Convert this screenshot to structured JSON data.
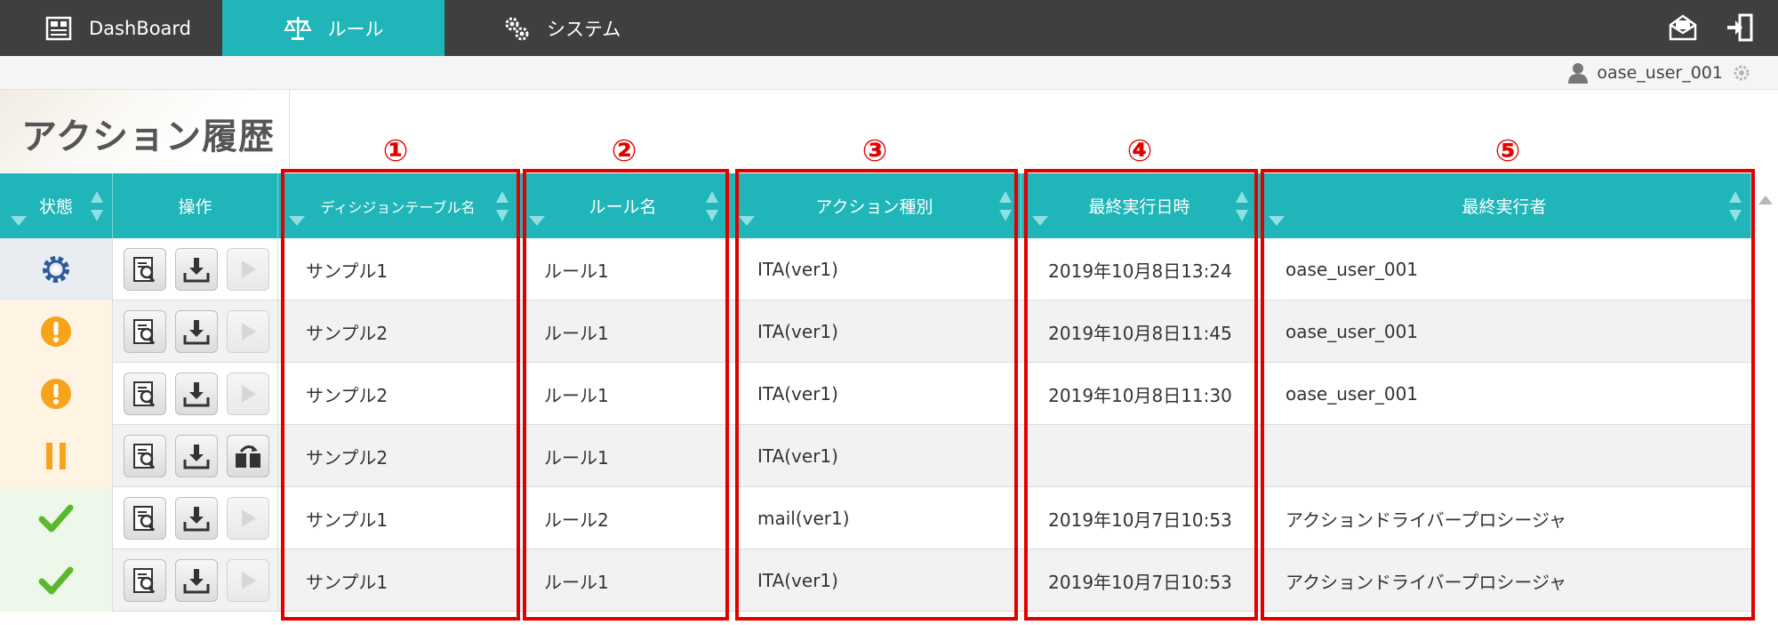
{
  "nav": {
    "dashboard_label": "DashBoard",
    "rule_label": "ルール",
    "system_label": "システム",
    "active_color": "#1fb5b9"
  },
  "user": {
    "name": "oase_user_001"
  },
  "page": {
    "title": "アクション履歴"
  },
  "table": {
    "headers": {
      "status": "状態",
      "operation": "操作",
      "decision_table": "ディシジョンテーブル名",
      "rule_name": "ルール名",
      "action_type": "アクション種別",
      "last_exec_time": "最終実行日時",
      "last_executor": "最終実行者"
    },
    "rows": [
      {
        "status": "running",
        "decision_table": "サンプル1",
        "rule_name": "ルール1",
        "action_type": "ITA(ver1)",
        "last_exec_time": "2019年10月8日13:24",
        "last_executor": "oase_user_001",
        "retry_enabled": false
      },
      {
        "status": "warning",
        "decision_table": "サンプル2",
        "rule_name": "ルール1",
        "action_type": "ITA(ver1)",
        "last_exec_time": "2019年10月8日11:45",
        "last_executor": "oase_user_001",
        "retry_enabled": false
      },
      {
        "status": "warning",
        "decision_table": "サンプル2",
        "rule_name": "ルール1",
        "action_type": "ITA(ver1)",
        "last_exec_time": "2019年10月8日11:30",
        "last_executor": "oase_user_001",
        "retry_enabled": false
      },
      {
        "status": "paused",
        "decision_table": "サンプル2",
        "rule_name": "ルール1",
        "action_type": "ITA(ver1)",
        "last_exec_time": "",
        "last_executor": "",
        "retry_enabled": true
      },
      {
        "status": "completed",
        "decision_table": "サンプル1",
        "rule_name": "ルール2",
        "action_type": "mail(ver1)",
        "last_exec_time": "2019年10月7日10:53",
        "last_executor": "アクションドライバープロシージャ",
        "retry_enabled": false
      },
      {
        "status": "completed",
        "decision_table": "サンプル1",
        "rule_name": "ルール1",
        "action_type": "ITA(ver1)",
        "last_exec_time": "2019年10月7日10:53",
        "last_executor": "アクションドライバープロシージャ",
        "retry_enabled": false
      }
    ]
  },
  "annotations": [
    "①",
    "②",
    "③",
    "④",
    "⑤"
  ],
  "colors": {
    "header": "#1fb5b9",
    "highlight": "#e10000",
    "warning": "#f7a41c",
    "ok": "#5ab82a",
    "running": "#2b5b9e"
  }
}
